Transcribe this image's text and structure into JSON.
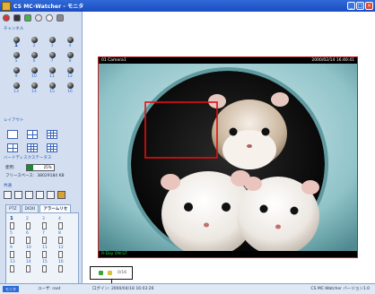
{
  "window": {
    "title": "CS MC-Watcher - モニタ",
    "minimize_glyph": "_",
    "maximize_glyph": "□",
    "close_glyph": "×"
  },
  "sidebar": {
    "channel_label": "チャンネル",
    "channels": [
      {
        "n": "1",
        "active": true
      },
      {
        "n": "2"
      },
      {
        "n": "3"
      },
      {
        "n": "4"
      },
      {
        "n": "5"
      },
      {
        "n": "6"
      },
      {
        "n": "7"
      },
      {
        "n": "8"
      },
      {
        "n": "9"
      },
      {
        "n": "10"
      },
      {
        "n": "11"
      },
      {
        "n": "12"
      },
      {
        "n": "13"
      },
      {
        "n": "14"
      },
      {
        "n": "15"
      },
      {
        "n": "16"
      }
    ],
    "layout_label": "レイアウト",
    "hdd_label": "ハードディスクステータス",
    "hdd_usage_label": "使用:",
    "hdd_usage_pct": "25%",
    "hdd_usage_fraction": 0.25,
    "hdd_free_label": "フリースペース:",
    "hdd_free_value": "38029184 KB",
    "common_label": "共通",
    "tabs": [
      "PTZ",
      "DIDO",
      "アラームリセ"
    ],
    "active_tab": 2,
    "cameras": [
      "1",
      "2",
      "3",
      "4",
      "5",
      "6",
      "7",
      "8",
      "9",
      "10",
      "11",
      "12",
      "13",
      "14",
      "15",
      "16"
    ]
  },
  "video": {
    "camera_name": "01 Camera1",
    "timestamp": "2000/02/14 16:40:41",
    "footer": "R-Day ON:ST"
  },
  "callout": {
    "text": "0/16"
  },
  "statusbar": {
    "badge": "モニタ",
    "user": "ユーザ: root",
    "login": "ログイン: 2000/04/18 16:03:26",
    "app": "CS MC-Watcher バージョン1.0"
  },
  "colors": {
    "title_bar": "#2f6ad8",
    "sidebar_bg": "#d3dff0",
    "frame_border": "#c02020",
    "selection_rect": "#e01010",
    "hdd_fill": "#1c8a2d"
  }
}
